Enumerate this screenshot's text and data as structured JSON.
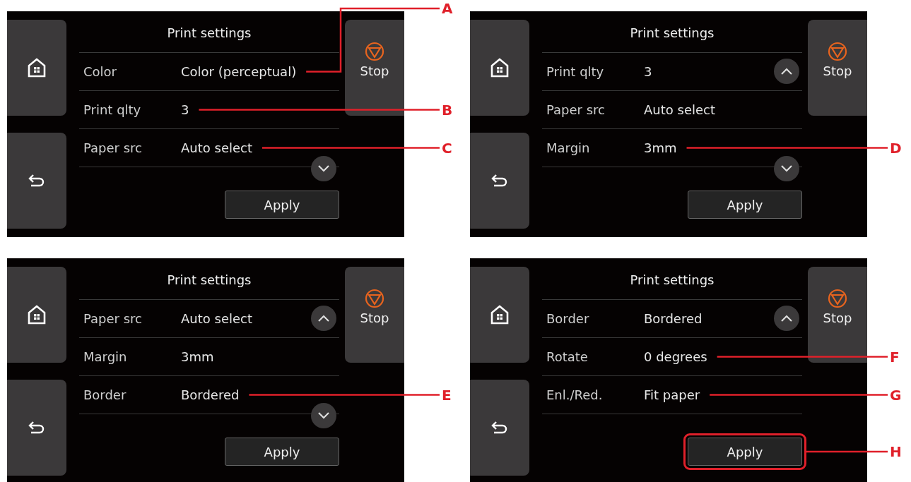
{
  "screens": [
    {
      "title": "Print settings",
      "rows": [
        {
          "label": "Color",
          "value": "Color (perceptual)",
          "callout": "A"
        },
        {
          "label": "Print qlty",
          "value": "3",
          "callout": "B"
        },
        {
          "label": "Paper src",
          "value": "Auto select",
          "callout": "C"
        }
      ],
      "scroll_up": false,
      "scroll_down": true,
      "stop": "Stop",
      "apply": {
        "label": "Apply"
      }
    },
    {
      "title": "Print settings",
      "rows": [
        {
          "label": "Print qlty",
          "value": "3"
        },
        {
          "label": "Paper src",
          "value": "Auto select"
        },
        {
          "label": "Margin",
          "value": "3mm",
          "callout": "D"
        }
      ],
      "scroll_up": true,
      "scroll_down": true,
      "stop": "Stop",
      "apply": {
        "label": "Apply"
      }
    },
    {
      "title": "Print settings",
      "rows": [
        {
          "label": "Paper src",
          "value": "Auto select"
        },
        {
          "label": "Margin",
          "value": "3mm"
        },
        {
          "label": "Border",
          "value": "Bordered",
          "callout": "E"
        }
      ],
      "scroll_up": true,
      "scroll_down": true,
      "stop": "Stop",
      "apply": {
        "label": "Apply"
      }
    },
    {
      "title": "Print settings",
      "rows": [
        {
          "label": "Border",
          "value": "Bordered"
        },
        {
          "label": "Rotate",
          "value": "0 degrees",
          "callout": "F"
        },
        {
          "label": "Enl./Red.",
          "value": "Fit paper",
          "callout": "G"
        }
      ],
      "scroll_up": true,
      "scroll_down": false,
      "stop": "Stop",
      "apply": {
        "label": "Apply",
        "callout": "H"
      }
    }
  ]
}
